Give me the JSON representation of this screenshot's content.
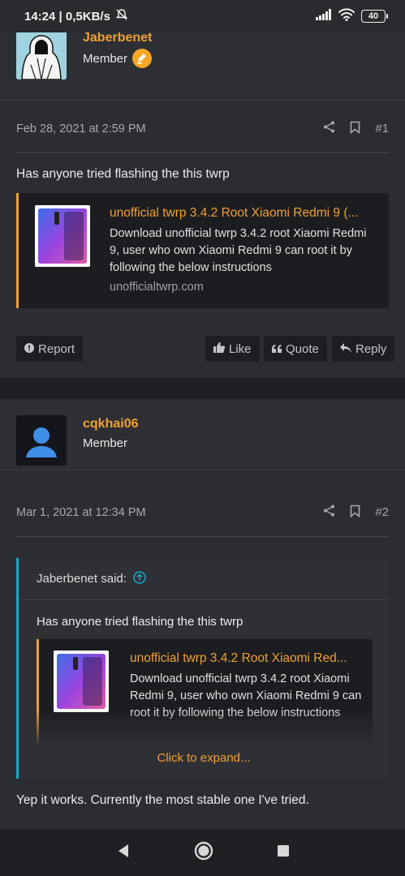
{
  "status": {
    "time_speed": "14:24 | 0,5KB/s",
    "battery": "40"
  },
  "post1": {
    "username": "Jaberbenet",
    "role": "Member",
    "date": "Feb 28, 2021 at 2:59 PM",
    "number": "#1",
    "text": "Has anyone tried flashing the this twrp",
    "embed": {
      "title": "unofficial twrp 3.4.2 Root Xiaomi Redmi 9 (...",
      "description": "Download unofficial twrp 3.4.2 root Xiaomi Redmi 9, user who own Xiaomi Redmi 9 can root it by following the below instructions",
      "domain": "unofficialtwrp.com"
    },
    "actions": {
      "report": "Report",
      "like": "Like",
      "quote": "Quote",
      "reply": "Reply"
    }
  },
  "post2": {
    "username": "cqkhai06",
    "role": "Member",
    "date": "Mar 1, 2021 at 12:34 PM",
    "number": "#2",
    "quote": {
      "author": "Jaberbenet said:",
      "text": "Has anyone tried flashing the this twrp",
      "embed": {
        "title": "unofficial twrp 3.4.2 Root Xiaomi Red...",
        "description": "Download unofficial twrp 3.4.2 root Xiaomi Redmi 9, user who own Xiaomi Redmi 9 can root it by following the below instructions"
      },
      "expand": "Click to expand..."
    },
    "text": "Yep it works. Currently the most stable one I've tried."
  },
  "colors": {
    "accent": "#f0a030",
    "quote_bar": "#1aa7c9",
    "background": "#1f2024",
    "card": "#2c2d32"
  },
  "icons": [
    "mute-bell-icon",
    "signal-icon",
    "wifi-icon",
    "share-icon",
    "bookmark-icon",
    "alert-icon",
    "thumbs-up-icon",
    "quote-icon",
    "reply-icon",
    "arrow-up-circle-icon",
    "back-icon",
    "home-icon",
    "recents-icon"
  ]
}
